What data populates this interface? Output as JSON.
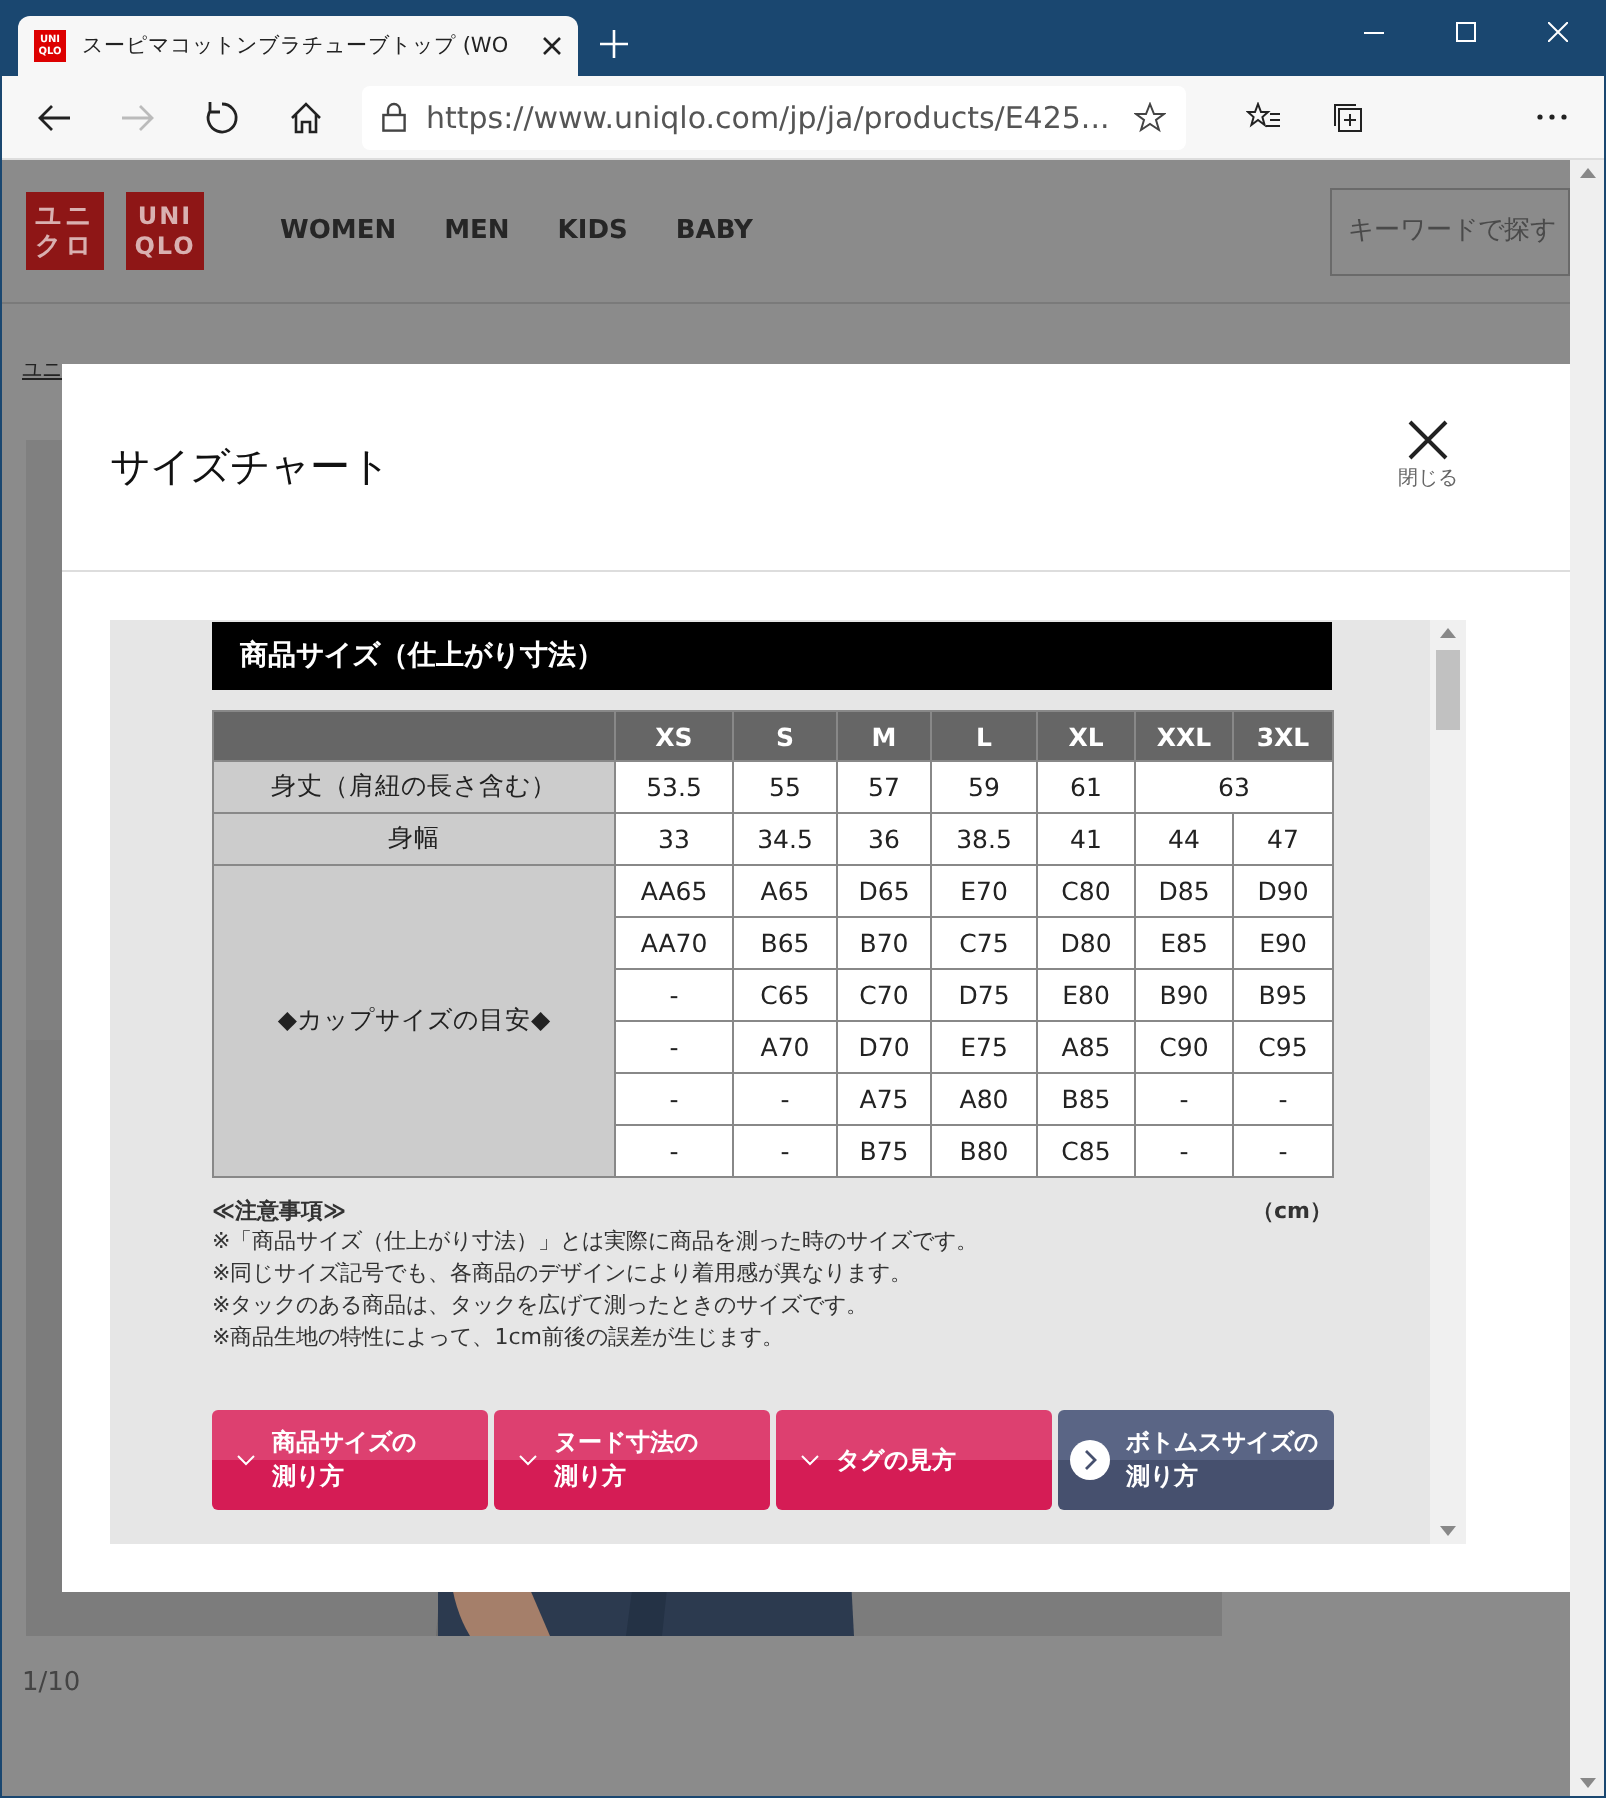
{
  "browser": {
    "favicon": [
      "UNI",
      "QLO"
    ],
    "tab_title": "スーピマコットンブラチューブトップ (WO",
    "url": "https://www.uniqlo.com/jp/ja/products/E425..."
  },
  "site": {
    "logo_katakana": [
      "ユニ",
      "クロ"
    ],
    "logo_latin": [
      "UNI",
      "QLO"
    ],
    "nav": [
      "WOMEN",
      "MEN",
      "KIDS",
      "BABY"
    ],
    "search": {
      "placeholder": "キーワードで探す"
    },
    "breadcrumb": "ユニ",
    "counter": "1/10"
  },
  "modal": {
    "title": "サイズチャート",
    "close_label": "閉じる",
    "section_title": "商品サイズ（仕上がり寸法）",
    "columns": [
      "XS",
      "S",
      "M",
      "L",
      "XL",
      "XXL",
      "3XL"
    ],
    "rows": [
      {
        "label": "身丈（肩紐の長さ含む）",
        "cells": [
          {
            "text": "53.5"
          },
          {
            "text": "55"
          },
          {
            "text": "57"
          },
          {
            "text": "59"
          },
          {
            "text": "61"
          },
          {
            "text": "63",
            "colspan": 2
          }
        ]
      },
      {
        "label": "身幅",
        "cells": [
          {
            "text": "33"
          },
          {
            "text": "34.5"
          },
          {
            "text": "36"
          },
          {
            "text": "38.5"
          },
          {
            "text": "41"
          },
          {
            "text": "44"
          },
          {
            "text": "47"
          }
        ]
      }
    ],
    "cup_guide": {
      "label": "◆カップサイズの目安◆",
      "rows": [
        [
          "AA65",
          "A65",
          "D65",
          "E70",
          "C80",
          "D85",
          "D90"
        ],
        [
          "AA70",
          "B65",
          "B70",
          "C75",
          "D80",
          "E85",
          "E90"
        ],
        [
          "-",
          "C65",
          "C70",
          "D75",
          "E80",
          "B90",
          "B95"
        ],
        [
          "-",
          "A70",
          "D70",
          "E75",
          "A85",
          "C90",
          "C95"
        ],
        [
          "-",
          "-",
          "A75",
          "A80",
          "B85",
          "-",
          "-"
        ],
        [
          "-",
          "-",
          "B75",
          "B80",
          "C85",
          "-",
          "-"
        ]
      ]
    },
    "notes_title": "≪注意事項≫",
    "unit": "（cm）",
    "notes": [
      "※「商品サイズ（仕上がり寸法）」とは実際に商品を測った時のサイズです。",
      "※同じサイズ記号でも、各商品のデザインにより着用感が異なります。",
      "※タックのある商品は、タックを広げて測ったときのサイズです。",
      "※商品生地の特性によって、1cm前後の誤差が生じます。"
    ],
    "buttons": [
      {
        "lines": [
          "商品サイズの",
          "測り方"
        ],
        "kind": "accordion"
      },
      {
        "lines": [
          "ヌード寸法の",
          "測り方"
        ],
        "kind": "accordion"
      },
      {
        "lines": [
          "タグの見方"
        ],
        "kind": "accordion"
      },
      {
        "lines": [
          "ボトムスサイズの",
          "測り方"
        ],
        "kind": "link"
      }
    ]
  }
}
